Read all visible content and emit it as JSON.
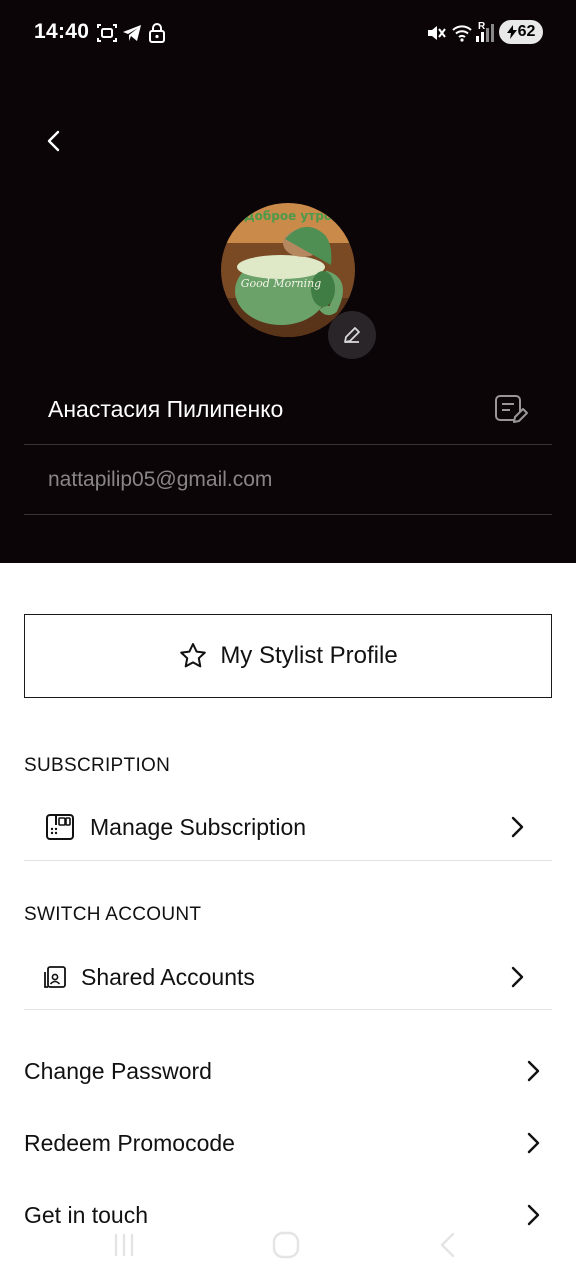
{
  "status_bar": {
    "time": "14:40",
    "battery": "62",
    "signal_r": "R"
  },
  "profile": {
    "name": "Анастасия Пилипенко",
    "email": "nattapilip05@gmail.com",
    "avatar_text_top": "Доброе утро",
    "avatar_text_mug": "Good Morning"
  },
  "stylist_button": {
    "label": "My Stylist Profile"
  },
  "subscription": {
    "section_label": "SUBSCRIPTION",
    "item_label": "Manage Subscription"
  },
  "switch_account": {
    "section_label": "SWITCH ACCOUNT",
    "item_label": "Shared Accounts"
  },
  "menu": [
    {
      "label": "Change Password"
    },
    {
      "label": "Redeem Promocode"
    },
    {
      "label": "Get in touch"
    }
  ],
  "icons": {
    "back": "chevron-left-icon",
    "avatar_edit": "pencil-icon",
    "name_edit": "edit-note-icon",
    "stylist": "star-icon",
    "subscription": "subscription-card-icon",
    "shared": "shared-accounts-icon",
    "chevron": "chevron-right-icon"
  },
  "colors": {
    "header_bg": "#0b0508",
    "body_bg": "#ffffff",
    "email_text": "#8a8587"
  }
}
